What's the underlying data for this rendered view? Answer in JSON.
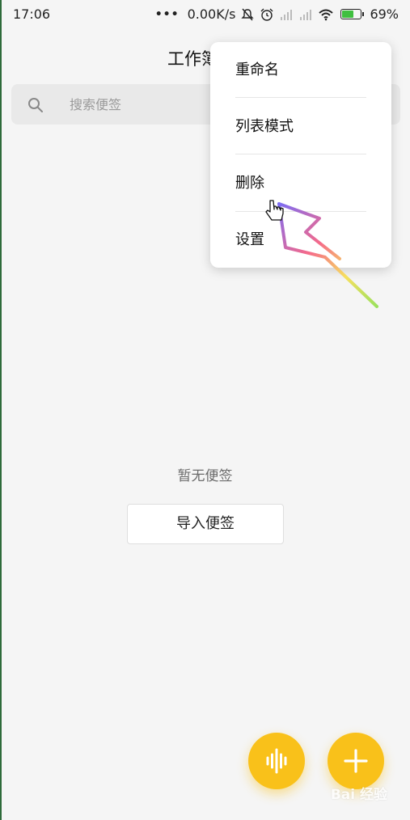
{
  "status_bar": {
    "time": "17:06",
    "network_speed": "0.00K/s",
    "battery": "69%",
    "battery_level": 0.69,
    "icons": [
      "more-dots-icon",
      "mute-bell-icon",
      "alarm-icon",
      "signal-icon",
      "signal-icon",
      "wifi-icon",
      "battery-icon"
    ]
  },
  "header": {
    "title": "工作簿"
  },
  "search": {
    "placeholder": "搜索便签",
    "value": ""
  },
  "menu": {
    "items": [
      {
        "label": "重命名"
      },
      {
        "label": "列表模式"
      },
      {
        "label": "删除"
      },
      {
        "label": "设置"
      }
    ]
  },
  "empty_state": {
    "text": "暂无便签",
    "import_label": "导入便签"
  },
  "fab": {
    "voice_icon": "waveform-icon",
    "add_icon": "plus-icon"
  },
  "colors": {
    "accent": "#f9c11a",
    "background": "#f5f5f5",
    "menu_background": "#ffffff"
  },
  "watermark": {
    "text": "Bai 经验"
  }
}
